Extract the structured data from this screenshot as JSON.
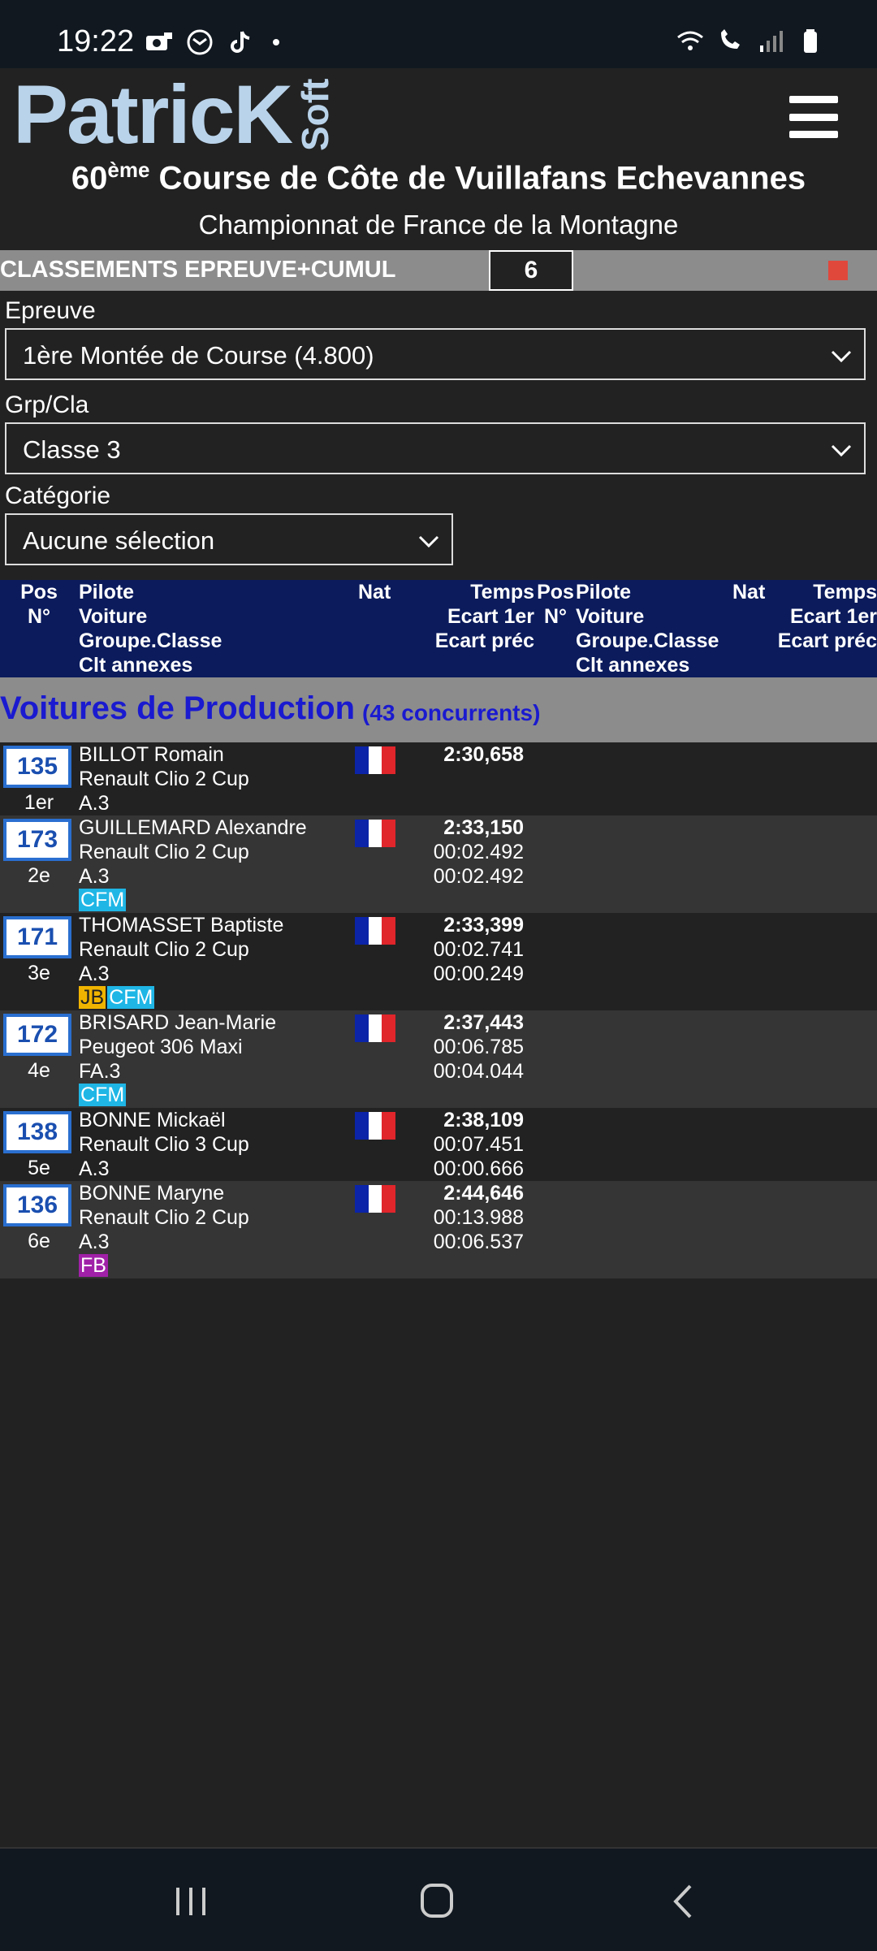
{
  "status_bar": {
    "time": "19:22"
  },
  "header": {
    "logo_main": "PatricK",
    "logo_soft": "Soft",
    "title_prefix": "60",
    "title_sup": "ème",
    "title_rest": " Course de Côte de Vuillafans Echevannes",
    "subtitle": "Championnat de France de la Montagne"
  },
  "classement": {
    "label": "CLASSEMENTS EPREUVE+CUMUL",
    "count": "6"
  },
  "filters": {
    "epreuve_label": "Epreuve",
    "epreuve_value": "1ère Montée de Course (4.800)",
    "grp_label": "Grp/Cla",
    "grp_value": "Classe 3",
    "cat_label": "Catégorie",
    "cat_value": "Aucune sélection"
  },
  "table_header": {
    "pos": "Pos",
    "num": "N°",
    "pilote": "Pilote",
    "voiture": "Voiture",
    "groupe": "Groupe.Classe",
    "clt": "Clt annexes",
    "nat": "Nat",
    "temps": "Temps",
    "ecart1": "Ecart 1er",
    "ecartp": "Ecart préc"
  },
  "group": {
    "name": "Voitures de Production",
    "count": "(43 concurrents)"
  },
  "rows": [
    {
      "num": "135",
      "pos": "1er",
      "pilot": "BILLOT Romain",
      "car": "Renault Clio 2 Cup",
      "class": "A.3",
      "time": "2:30,658",
      "gap_first": "",
      "gap_prev": "",
      "badges": []
    },
    {
      "num": "173",
      "pos": "2e",
      "pilot": "GUILLEMARD Alexandre",
      "car": "Renault Clio 2 Cup",
      "class": "A.3",
      "time": "2:33,150",
      "gap_first": "00:02.492",
      "gap_prev": "00:02.492",
      "badges": [
        "CFM"
      ]
    },
    {
      "num": "171",
      "pos": "3e",
      "pilot": "THOMASSET Baptiste",
      "car": "Renault Clio 2 Cup",
      "class": "A.3",
      "time": "2:33,399",
      "gap_first": "00:02.741",
      "gap_prev": "00:00.249",
      "badges": [
        "JB",
        "CFM"
      ]
    },
    {
      "num": "172",
      "pos": "4e",
      "pilot": "BRISARD Jean-Marie",
      "car": "Peugeot 306 Maxi",
      "class": "FA.3",
      "time": "2:37,443",
      "gap_first": "00:06.785",
      "gap_prev": "00:04.044",
      "badges": [
        "CFM"
      ]
    },
    {
      "num": "138",
      "pos": "5e",
      "pilot": "BONNE Mickaël",
      "car": "Renault Clio 3 Cup",
      "class": "A.3",
      "time": "2:38,109",
      "gap_first": "00:07.451",
      "gap_prev": "00:00.666",
      "badges": []
    },
    {
      "num": "136",
      "pos": "6e",
      "pilot": "BONNE Maryne",
      "car": "Renault Clio 2 Cup",
      "class": "A.3",
      "time": "2:44,646",
      "gap_first": "00:13.988",
      "gap_prev": "00:06.537",
      "badges": [
        "FB"
      ]
    }
  ],
  "colors": {
    "background": "#222222",
    "table_header": "#0b1b5c",
    "group_bar": "#8c8c8c",
    "group_text": "#1a1ad0",
    "badge_cfm": "#1fb6e6",
    "badge_jb": "#f0b400",
    "badge_fb": "#a021a8",
    "stop": "#e0483c"
  }
}
